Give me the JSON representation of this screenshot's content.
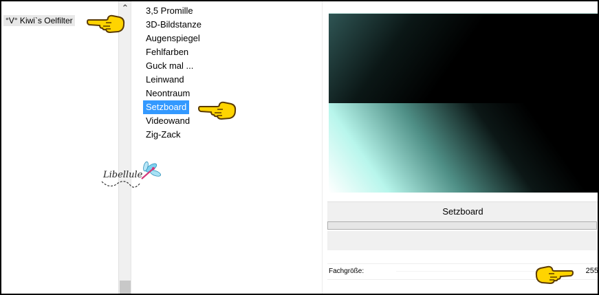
{
  "categories": {
    "items": [
      {
        "label": "°V° Kiwi`s Oelfilter"
      }
    ]
  },
  "filters": {
    "items": [
      {
        "label": "3,5 Promille",
        "selected": false
      },
      {
        "label": "3D-Bildstanze",
        "selected": false
      },
      {
        "label": "Augenspiegel",
        "selected": false
      },
      {
        "label": "Fehlfarben",
        "selected": false
      },
      {
        "label": "Guck mal ...",
        "selected": false
      },
      {
        "label": "Leinwand",
        "selected": false
      },
      {
        "label": "Neontraum",
        "selected": false
      },
      {
        "label": "Setzboard",
        "selected": true
      },
      {
        "label": "Videowand",
        "selected": false
      },
      {
        "label": "Zig-Zack",
        "selected": false
      }
    ]
  },
  "preview": {
    "filter_name": "Setzboard",
    "progress": 0
  },
  "parameter": {
    "label": "Fachgröße:",
    "value": "255"
  },
  "watermark": {
    "text": "Libellule"
  },
  "colors": {
    "selection": "#3399ff",
    "hand_fill": "#ffd400",
    "hand_outline": "#5a3a00"
  },
  "icons": {
    "scroll_up": "chevron-up-icon",
    "pointer": "pointing-hand-icon"
  }
}
